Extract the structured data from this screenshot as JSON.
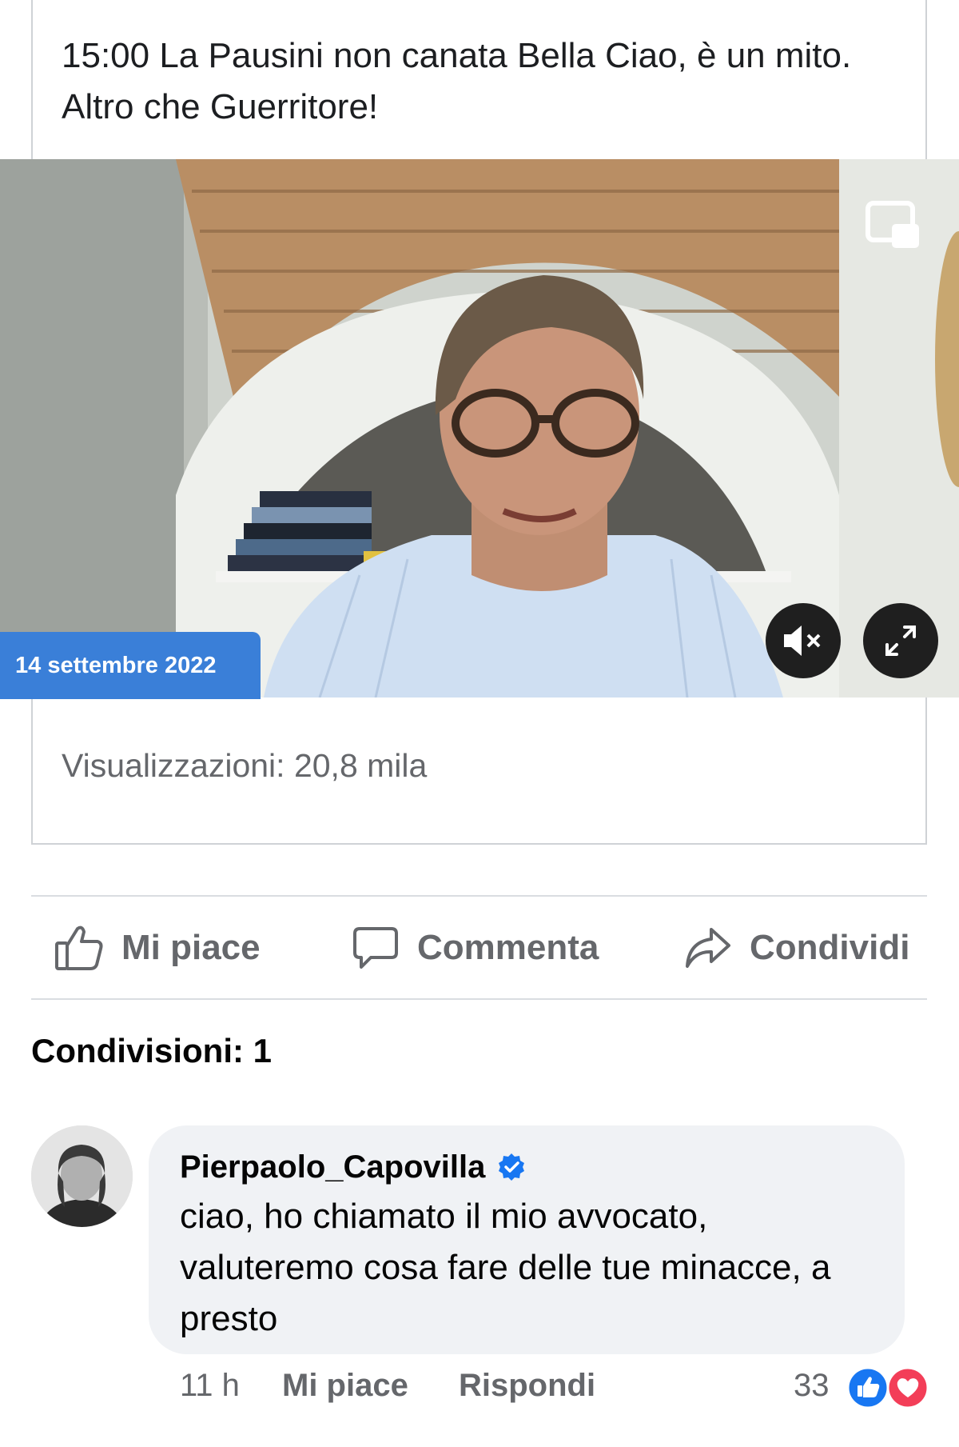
{
  "post": {
    "text": "15:00 La Pausini non canata Bella Ciao, è un mito. Altro che Guerritore!",
    "video": {
      "date_badge": "14 settembre 2022",
      "icons": [
        "picture-in-picture-icon",
        "mute-icon",
        "fullscreen-icon"
      ]
    },
    "views": "Visualizzazioni: 20,8 mila"
  },
  "actions": {
    "like": "Mi piace",
    "comment": "Commenta",
    "share": "Condividi"
  },
  "shares": "Condivisioni: 1",
  "comment": {
    "author": "Pierpaolo_Capovilla",
    "verified": true,
    "text": "ciao, ho chiamato il mio avvocato, valuteremo cosa fare delle tue minacce, a presto",
    "time": "11 h",
    "like_label": "Mi piace",
    "reply_label": "Rispondi",
    "reaction_count": "33",
    "reactions": [
      "like-icon",
      "love-icon"
    ]
  },
  "colors": {
    "accent": "#1877f2",
    "badge": "#3a7fd8",
    "love": "#f33e58",
    "muted_text": "#65676b",
    "bubble": "#f0f2f5"
  }
}
